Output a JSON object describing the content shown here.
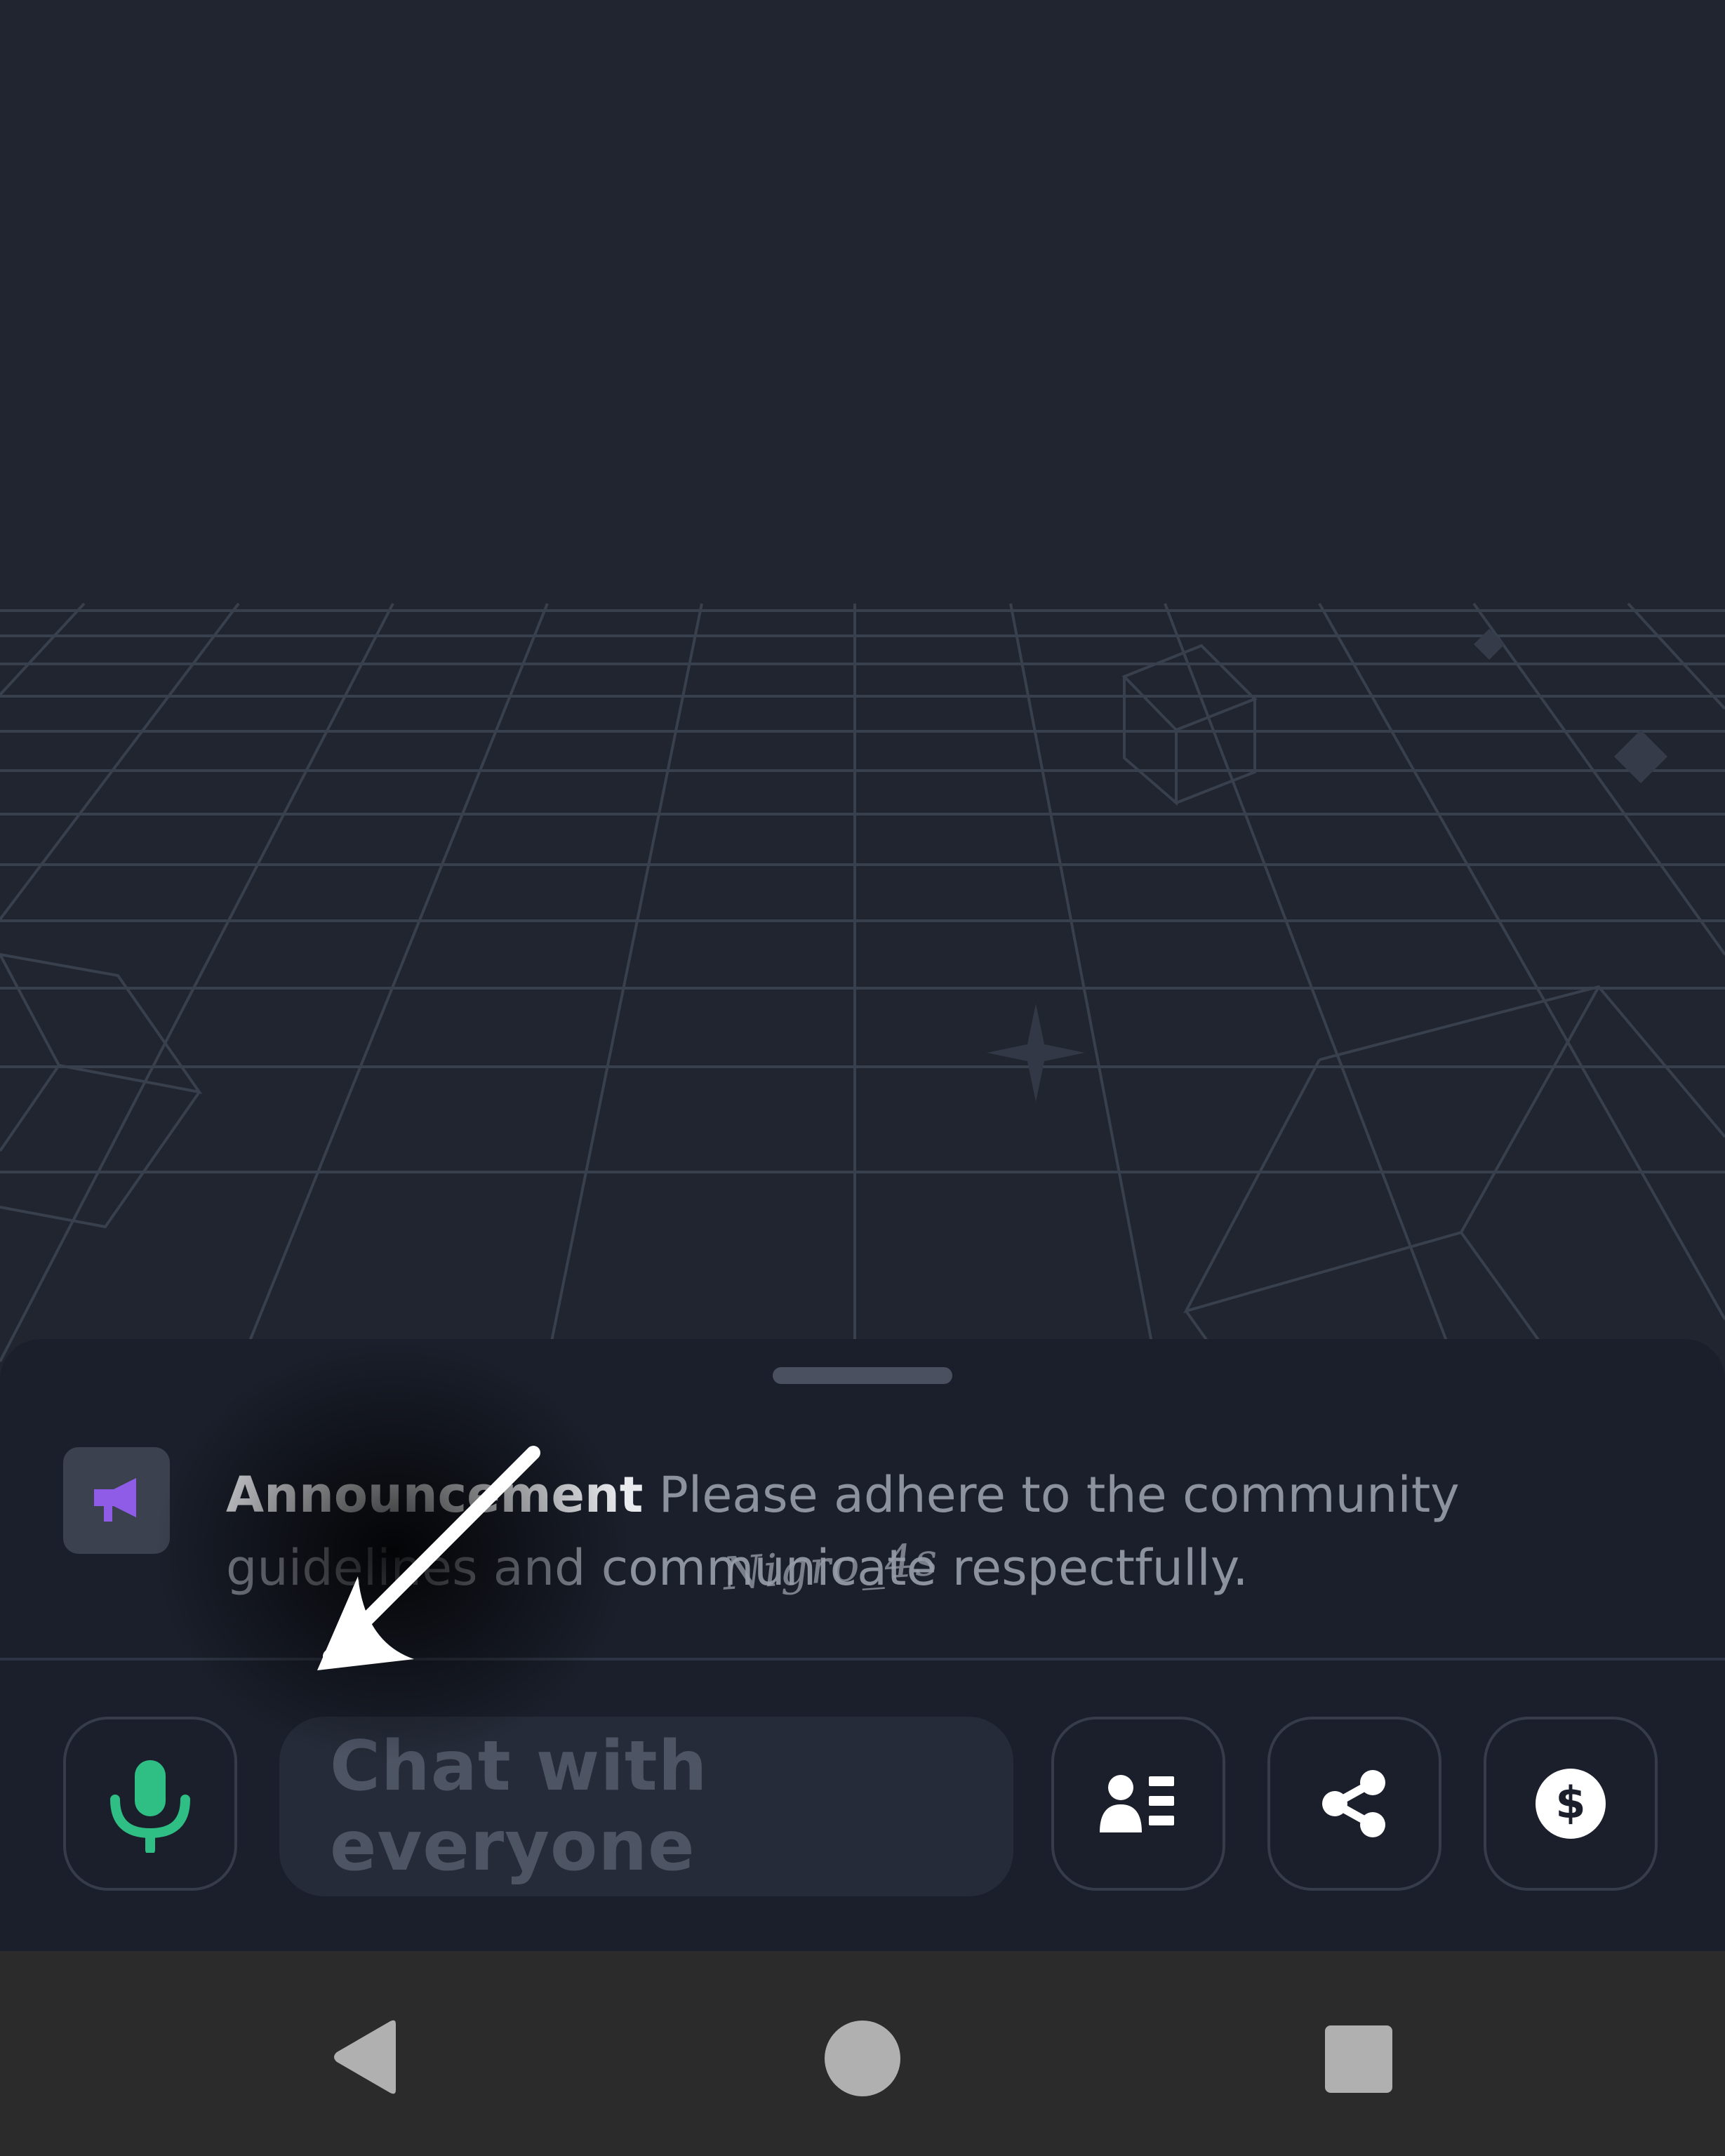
{
  "announcement": {
    "icon": "megaphone-icon",
    "title": "Announcement",
    "message": "Please adhere to the community guidelines and communicate respectfully."
  },
  "chat_bar": {
    "mic_icon": "microphone-icon",
    "input_placeholder": "Chat with everyone",
    "participants_icon": "participants-list-icon",
    "share_icon": "share-icon",
    "tip_icon": "dollar-coin-icon"
  },
  "navigation": {
    "back_icon": "back-triangle-icon",
    "home_icon": "home-circle-icon",
    "recents_icon": "recents-square-icon"
  },
  "overlay": {
    "watermark": "Nigro_4s",
    "annotation_icon": "arrow-pointer-icon"
  },
  "colors": {
    "background": "#20252f",
    "sheet": "#1a1f2b",
    "mic_accent": "#2fbf84",
    "megaphone_accent": "#8e5ce6",
    "grid_line": "#3a404d"
  }
}
